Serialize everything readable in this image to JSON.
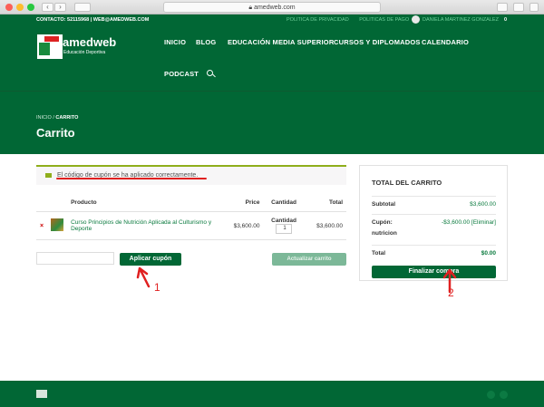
{
  "browser": {
    "url": "amedweb.com"
  },
  "topbar": {
    "contact": "CONTACTO: 52115968 | WEB@AMEDWEB.COM",
    "links": [
      "POLITICA DE PRIVACIDAD",
      "POLITICAS DE PAGO"
    ],
    "user": "DANIELA MARTINEZ GONZALEZ",
    "cart_count": "0"
  },
  "header": {
    "logo_text": "amedweb",
    "logo_sub": "Educación Deportiva",
    "nav": [
      "INICIO",
      "BLOG",
      "EDUCACIÓN MEDIA SUPERIOR",
      "CURSOS Y DIPLOMADOS",
      "CALENDARIO",
      "PODCAST"
    ]
  },
  "band": {
    "breadcrumb_home": "INICIO",
    "breadcrumb_sep": "/",
    "breadcrumb_current": "CARRITO",
    "title": "Carrito"
  },
  "notice": {
    "message": "El código de cupón se ha aplicado correctamente."
  },
  "cart": {
    "headers": {
      "product": "Producto",
      "price": "Price",
      "qty": "Cantidad",
      "total": "Total"
    },
    "row": {
      "remove": "×",
      "name": "Curso Principios de Nutrición Aplicada al Culturismo y Deporte",
      "price": "$3,600.00",
      "qty_label": "Cantidad",
      "qty": "1",
      "total": "$3,600.00"
    },
    "apply_coupon": "Aplicar cupón",
    "update_cart": "Actualizar carrito"
  },
  "totals": {
    "title": "TOTAL DEL CARRITO",
    "subtotal_label": "Subtotal",
    "subtotal": "$3,600.00",
    "coupon_label": "Cupón:",
    "coupon_code": "nutricion",
    "coupon_value": "-$3,600.00 [Eliminar]",
    "total_label": "Total",
    "total": "$0.00",
    "checkout": "Finalizar compra"
  },
  "annotations": {
    "one": "1",
    "two": "2"
  },
  "colors": {
    "brand": "#016735",
    "annotation": "#e02020",
    "notice_accent": "#8fae1b"
  }
}
